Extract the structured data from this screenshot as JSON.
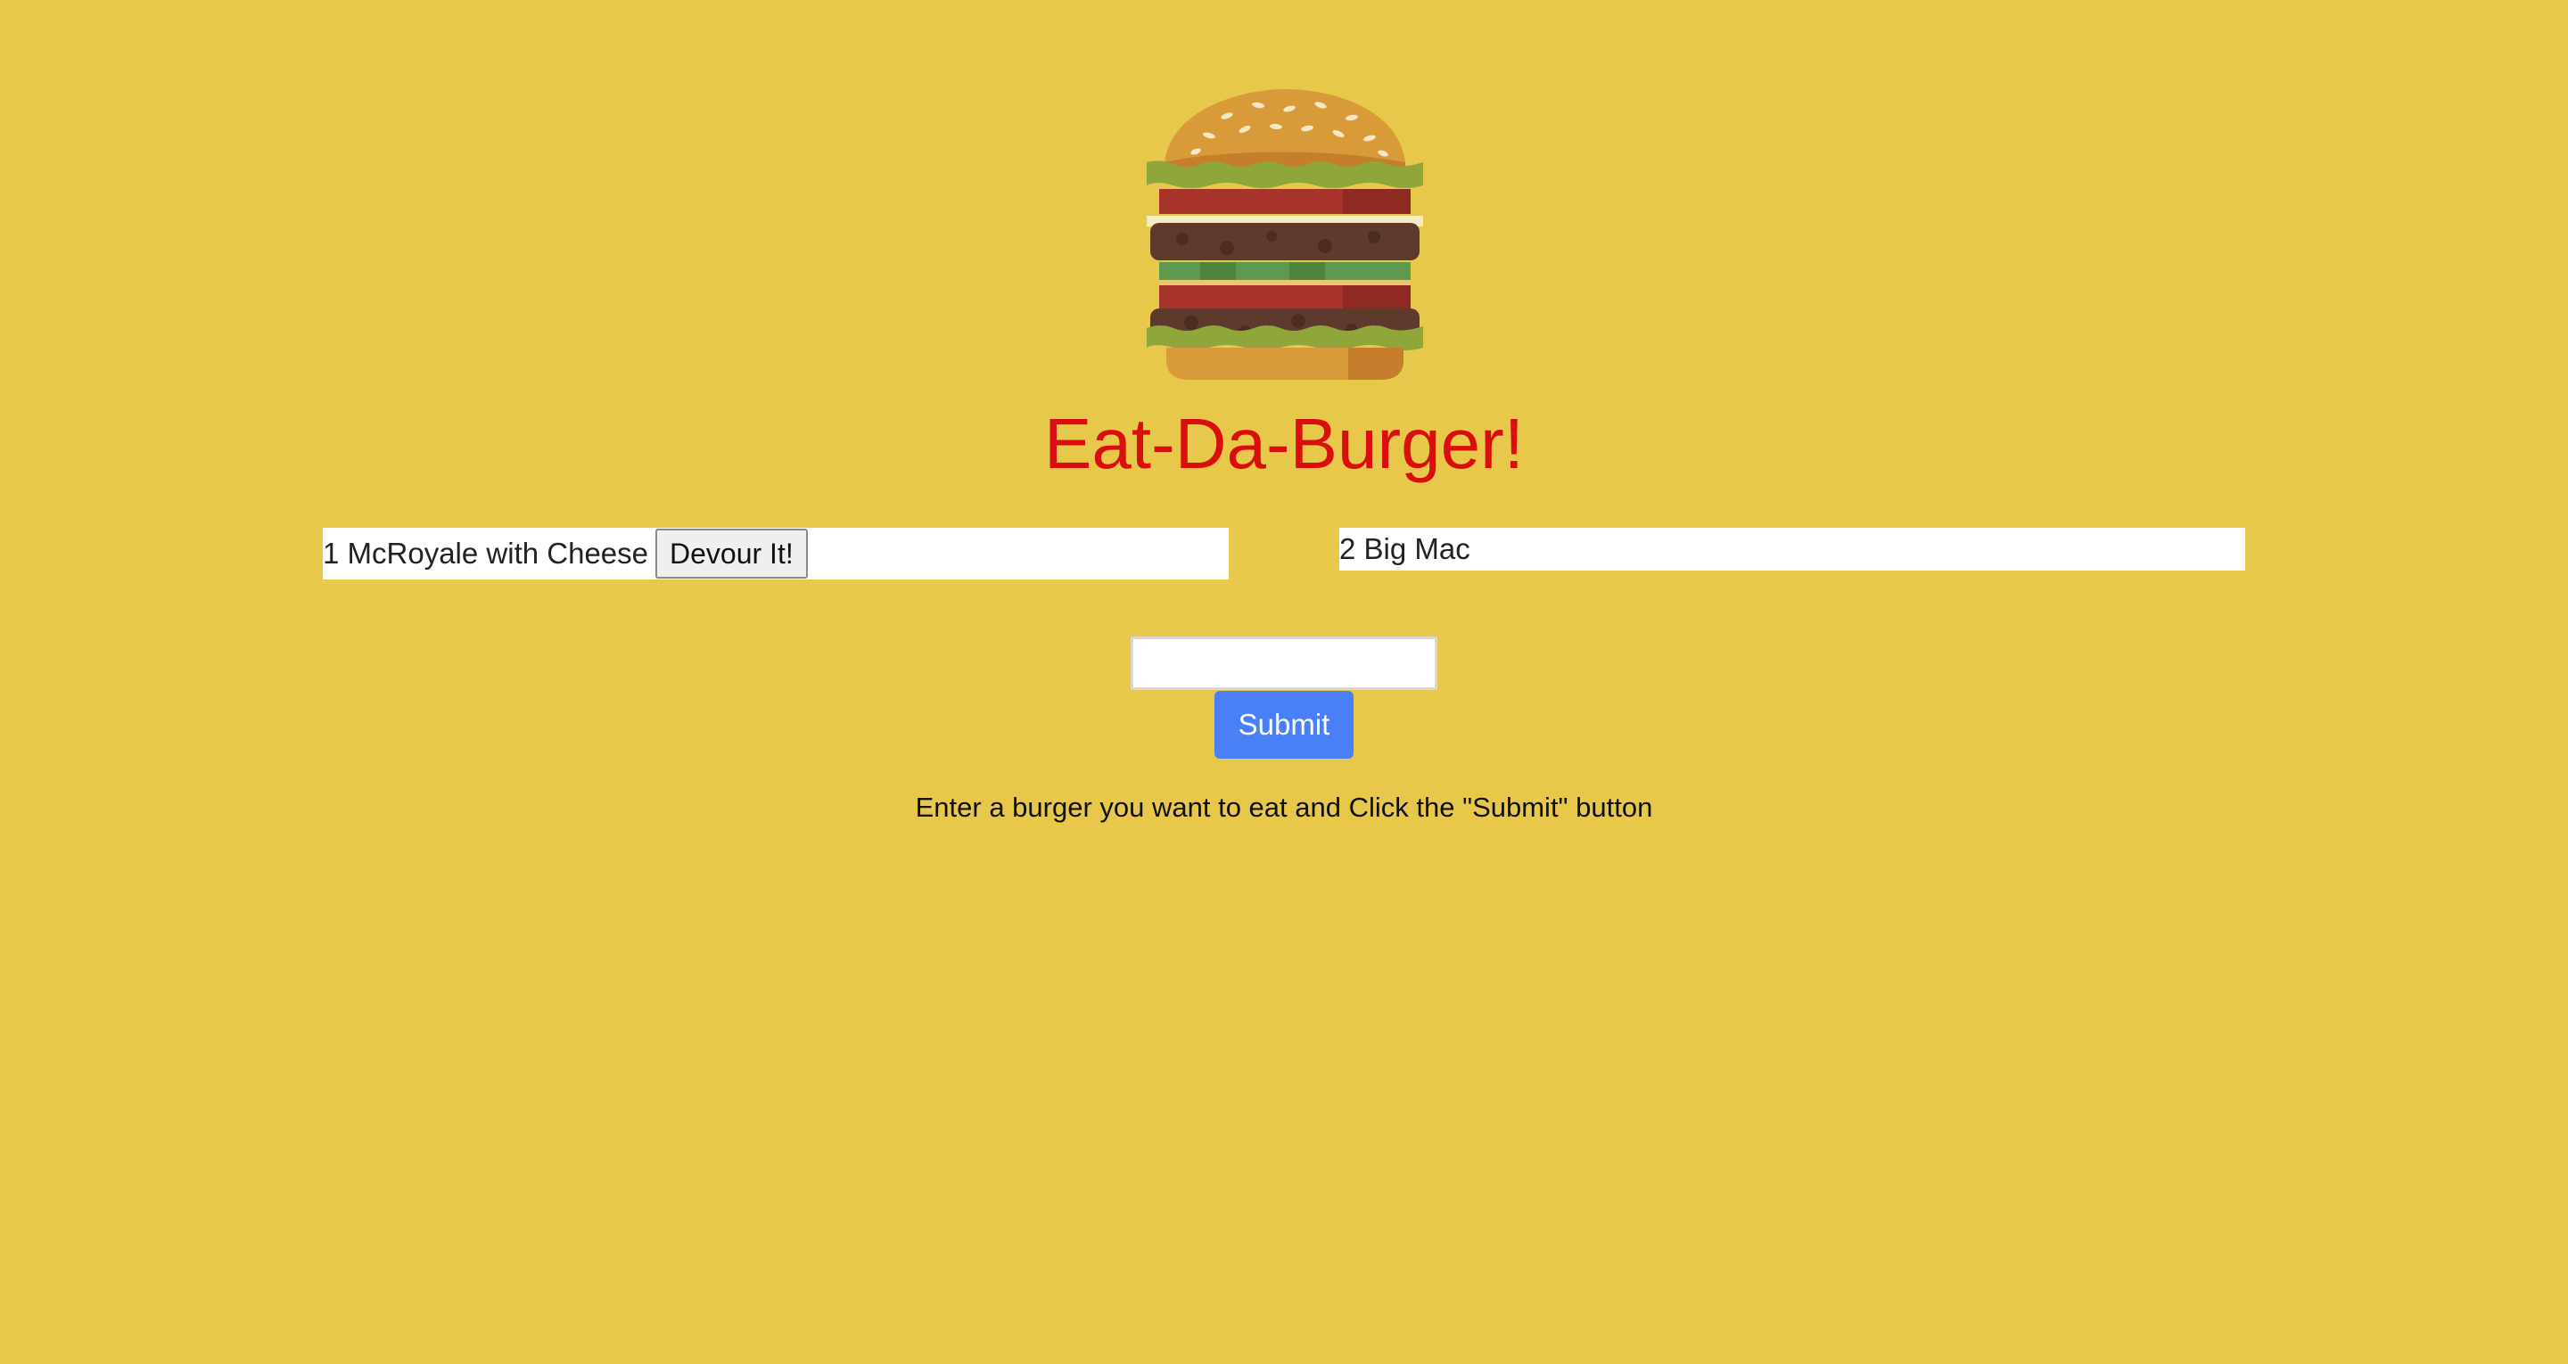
{
  "header": {
    "logo_icon": "burger-icon",
    "title": "Eat-Da-Burger!"
  },
  "burgers": {
    "uneaten": [
      {
        "label": "1 McRoyale with Cheese",
        "action_label": "Devour It!"
      }
    ],
    "devoured": [
      {
        "label": "2 Big Mac"
      }
    ]
  },
  "form": {
    "input_value": "",
    "input_placeholder": "",
    "submit_label": "Submit",
    "instructions": "Enter a burger you want to eat and Click the \"Submit\" button"
  },
  "colors": {
    "background": "#e8c84a",
    "title": "#d90e0e",
    "submit_button": "#4a80f5"
  }
}
